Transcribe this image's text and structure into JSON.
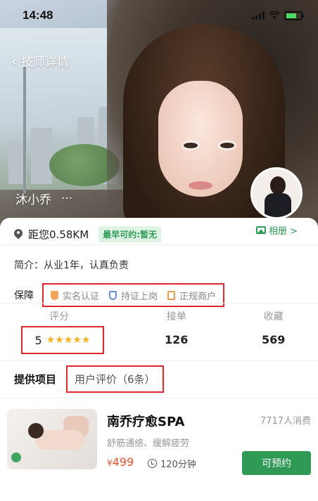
{
  "status_bar": {
    "time": "14:48"
  },
  "header": {
    "title": "技师详情"
  },
  "hero": {
    "therapist_name": "沐小乔",
    "more": "···"
  },
  "profile": {
    "distance": "距您0.58KM",
    "earliest_badge": "最早可约:暂无",
    "album_label": "相册 >",
    "intro": "简介：从业1年，认真负责"
  },
  "guarantee": {
    "label": "保障",
    "items": [
      "实名认证",
      "持证上岗",
      "正规商户"
    ]
  },
  "stats": {
    "rating_label": "评分",
    "rating_value": "5",
    "rating_stars": 5,
    "orders_label": "接单",
    "orders_value": "126",
    "favorites_label": "收藏",
    "favorites_value": "569"
  },
  "tabs": {
    "services": "提供项目",
    "reviews": "用户评价（6条）"
  },
  "service": {
    "title": "南乔疗愈SPA",
    "count": "7717人消费",
    "subtitle": "舒筋通络、缓解疲劳",
    "price_symbol": "¥",
    "price": "499",
    "duration": "120分钟",
    "book_label": "可预约"
  },
  "colors": {
    "accent_green": "#2e9a55",
    "price_orange": "#e8542f",
    "highlight_red": "#e0262f",
    "star_gold": "#f5b21f"
  }
}
